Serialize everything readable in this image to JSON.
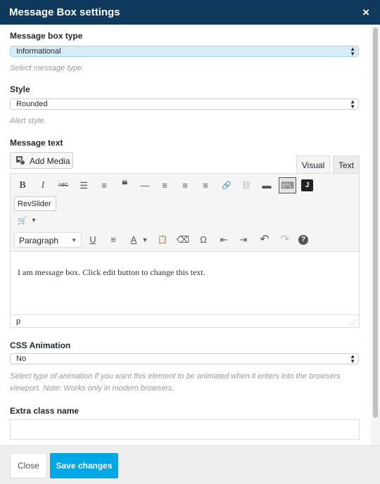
{
  "window": {
    "title": "Message Box settings",
    "close_glyph": "×"
  },
  "fields": {
    "message_box_type": {
      "label": "Message box type",
      "value": "Informational",
      "hint": "Select message type."
    },
    "style": {
      "label": "Style",
      "value": "Rounded",
      "hint": "Alert style."
    },
    "message_text": {
      "label": "Message text"
    },
    "css_animation": {
      "label": "CSS Animation",
      "value": "No",
      "hint": "Select type of animation if you want this element to be animated when it enters into the browsers viewport. Note: Works only in modern browsers."
    },
    "extra_class": {
      "label": "Extra class name",
      "value": ""
    }
  },
  "editor": {
    "add_media_label": "Add Media",
    "tabs": {
      "visual": "Visual",
      "text": "Text"
    },
    "revslider_label": "RevSlider",
    "format_value": "Paragraph",
    "content": "I am message box. Click edit button to change this text.",
    "status_path": "p",
    "toolbar_glyphs": {
      "bold": "B",
      "italic": "I",
      "strikethrough": "ABC",
      "bullet_list": "☰",
      "numbered_list": "≡",
      "blockquote": "❝",
      "hr": "—",
      "align_left": "≡",
      "align_center": "≡",
      "align_right": "≡",
      "link": "🔗",
      "unlink": "⛓",
      "read_more": "▬",
      "kitchen_sink": "⌨",
      "j_button": "J",
      "cart": "🛒",
      "cart_caret": "▾",
      "underline": "U",
      "justify": "≡",
      "text_color": "A",
      "paste_text": "📋",
      "clear_format": "⌫",
      "special_char": "Ω",
      "outdent": "⇤",
      "indent": "⇥",
      "undo": "↶",
      "redo": "↷",
      "help": "?"
    }
  },
  "footer": {
    "close_label": "Close",
    "save_label": "Save changes"
  },
  "colors": {
    "titlebar": "#0f3a5e",
    "primary": "#00a7e6",
    "info_select": "#d6edf8"
  }
}
